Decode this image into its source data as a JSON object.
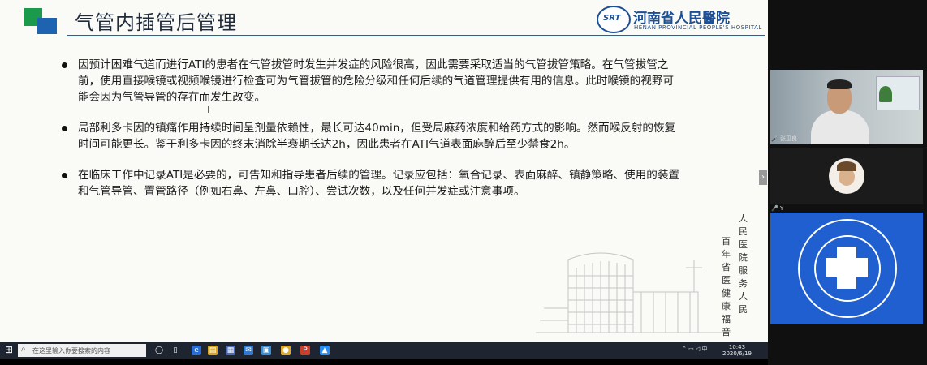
{
  "slide": {
    "title": "气管内插管后管理",
    "hospital_name": "河南省人民醫院",
    "hospital_name_en": "HENAN PROVINCIAL PEOPLE'S HOSPITAL",
    "emblem_text": "SRT",
    "bullets": [
      "因预计困难气道而进行ATI的患者在气管拔管时发生并发症的风险很高，因此需要采取适当的气管拔管策略。在气管拔管之前，使用直接喉镜或视频喉镜进行检查可为气管拔管的危险分级和任何后续的气道管理提供有用的信息。此时喉镜的视野可能会因为气管导管的存在而发生改变。",
      "局部利多卡因的镇痛作用持续时间呈剂量依赖性，最长可达40min，但受局麻药浓度和给药方式的影响。然而喉反射的恢复时间可能更长。鉴于利多卡因的终末消除半衰期长达2h，因此患者在ATI气道表面麻醉后至少禁食2h。",
      "在临床工作中记录ATI是必要的，可告知和指导患者后续的管理。记录应包括：氧合记录、表面麻醉、镇静策略、使用的装置和气管导管、置管路径（例如右鼻、左鼻、口腔）、尝试次数，以及任何并发症或注意事项。"
    ],
    "calligraphy_col1": "人民医院服务人民",
    "calligraphy_col2": "百年省医健康福音",
    "arrow": "›"
  },
  "taskbar": {
    "search_placeholder": "在这里输入你要搜索的内容",
    "time": "10:43",
    "date": "2020/6/19"
  },
  "participants": {
    "video_name": "张卫良",
    "avatar_name": "Y"
  }
}
